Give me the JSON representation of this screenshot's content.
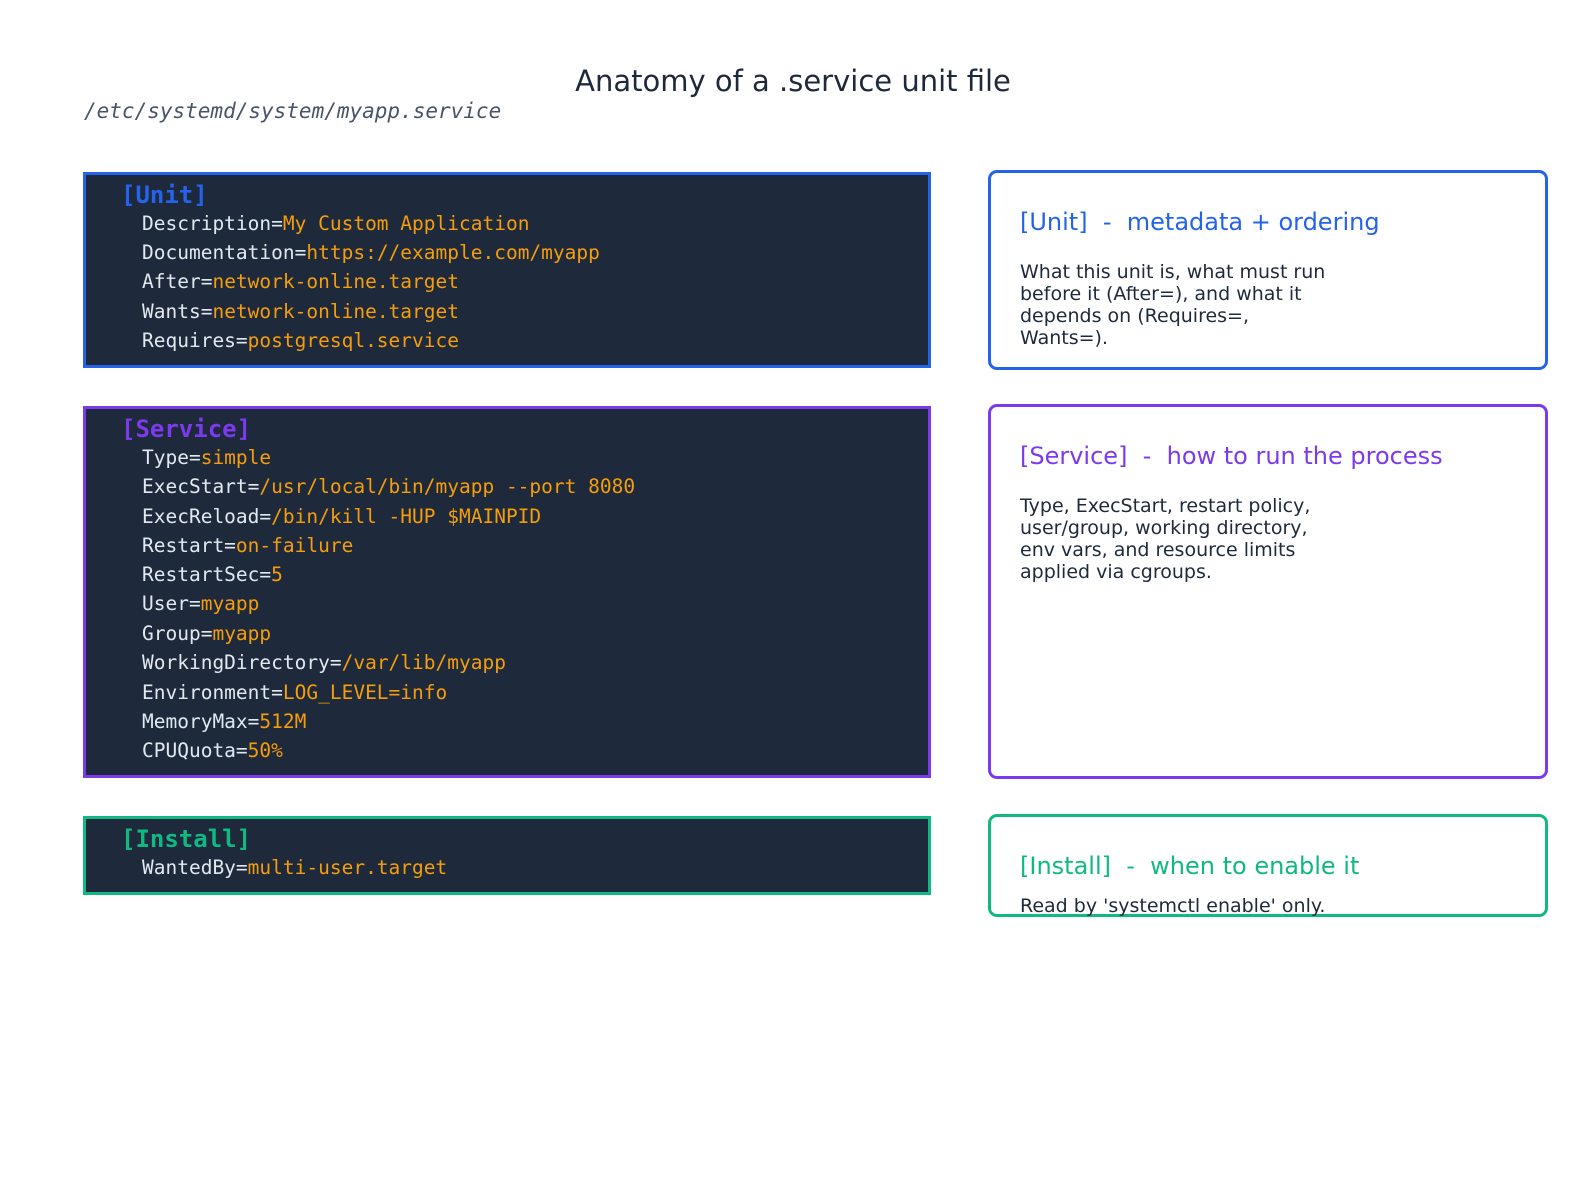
{
  "title": "Anatomy of a .service unit file",
  "file_path": "/etc/systemd/system/myapp.service",
  "colors": {
    "unit": "#2563eb",
    "service": "#7c3aed",
    "install": "#10b981",
    "code_bg": "#1e293b",
    "code_key": "#e2e8f0",
    "code_value": "#f59e0b",
    "text": "#1e293b"
  },
  "sections": {
    "unit": {
      "header": "[Unit]",
      "lines": [
        {
          "key": "Description=",
          "value": "My Custom Application"
        },
        {
          "key": "Documentation=",
          "value": "https://example.com/myapp"
        },
        {
          "key": "After=",
          "value": "network-online.target"
        },
        {
          "key": "Wants=",
          "value": "network-online.target"
        },
        {
          "key": "Requires=",
          "value": "postgresql.service"
        }
      ],
      "note_title": "[Unit]  -  metadata + ordering",
      "note_body": "What this unit is, what must run before it (After=), and what it depends on (Requires=, Wants=)."
    },
    "service": {
      "header": "[Service]",
      "lines": [
        {
          "key": "Type=",
          "value": "simple"
        },
        {
          "key": "ExecStart=",
          "value": "/usr/local/bin/myapp --port 8080"
        },
        {
          "key": "ExecReload=",
          "value": "/bin/kill -HUP $MAINPID"
        },
        {
          "key": "Restart=",
          "value": "on-failure"
        },
        {
          "key": "RestartSec=",
          "value": "5"
        },
        {
          "key": "User=",
          "value": "myapp"
        },
        {
          "key": "Group=",
          "value": "myapp"
        },
        {
          "key": "WorkingDirectory=",
          "value": "/var/lib/myapp"
        },
        {
          "key": "Environment=",
          "value": "LOG_LEVEL=info"
        },
        {
          "key": "MemoryMax=",
          "value": "512M"
        },
        {
          "key": "CPUQuota=",
          "value": "50%"
        }
      ],
      "note_title": "[Service]  -  how to run the process",
      "note_body": "Type, ExecStart, restart policy, user/group, working directory, env vars, and resource limits applied via cgroups."
    },
    "install": {
      "header": "[Install]",
      "lines": [
        {
          "key": "WantedBy=",
          "value": "multi-user.target"
        }
      ],
      "note_title": "[Install]  -  when to enable it",
      "note_body": "Read by 'systemctl enable' only."
    }
  }
}
